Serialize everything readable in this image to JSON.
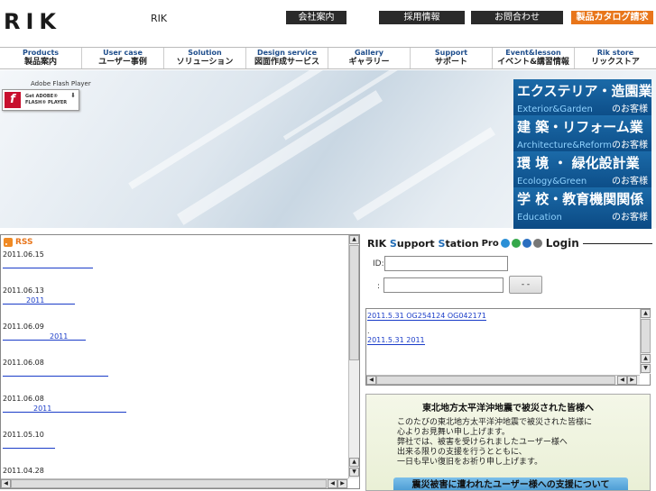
{
  "header": {
    "logo": "RIK",
    "site_name": "RIK",
    "top_buttons": [
      "会社案内",
      "採用情報",
      "お問合わせ"
    ],
    "catalog_button": "製品カタログ請求"
  },
  "nav": [
    {
      "en": "Products",
      "jp": "製品案内"
    },
    {
      "en": "User case",
      "jp": "ユーザー事例"
    },
    {
      "en": "Solution",
      "jp": "ソリューション"
    },
    {
      "en": "Design service",
      "jp": "図面作成サービス"
    },
    {
      "en": "Gallery",
      "jp": "ギャラリー"
    },
    {
      "en": "Support",
      "jp": "サポート"
    },
    {
      "en": "Event&lesson",
      "jp": "イベント&講習情報"
    },
    {
      "en": "Rik store",
      "jp": "リックストア"
    }
  ],
  "flash": {
    "label": "Adobe Flash Player",
    "badge_line1": "Get ADOBE®",
    "badge_line2": "FLASH® PLAYER"
  },
  "customers": [
    {
      "jp": "エクステリア・造園業",
      "en": "Exterior&Garden",
      "suffix": "のお客様"
    },
    {
      "jp": "建 築・リフォーム業",
      "en": "Architecture&Reform",
      "suffix": "のお客様"
    },
    {
      "jp": "環 境 ・ 緑化設計業",
      "en": "Ecology&Green",
      "suffix": "のお客様"
    },
    {
      "jp": "学 校・教育機関関係",
      "en": "Education",
      "suffix": "のお客様"
    }
  ],
  "rss": {
    "label": "RSS",
    "items": [
      {
        "date": "2011.06.15",
        "link": ""
      },
      {
        "date": "2011.06.13",
        "link": "2011"
      },
      {
        "date": "2011.06.09",
        "link": "2011"
      },
      {
        "date": "2011.06.08",
        "link": ""
      },
      {
        "date": "2011.06.08",
        "link": "2011"
      },
      {
        "date": "2011.05.10",
        "link": ""
      },
      {
        "date": "2011.04.28",
        "link": ""
      }
    ]
  },
  "support_station": {
    "title_a": "RIK ",
    "title_b": "S",
    "title_c": "upport ",
    "title_d": "S",
    "title_e": "tation",
    "pro": "Pro",
    "login": "Login",
    "id_label": "ID:",
    "pw_label": ":",
    "login_button": "- -"
  },
  "link_box": {
    "row1": "2011.5.31          OG254124    OG042171",
    "row2": ".",
    "row3": "2011.5.31          2011"
  },
  "notice": {
    "heading": "東北地方太平洋沖地震で被災された皆様へ",
    "lines": [
      "このたびの東北地方太平洋沖地震で被災された皆様に",
      "心よりお見舞い申し上げます。",
      "弊社では、被害を受けられましたユーザー様へ",
      "出来る限りの支援を行うとともに、",
      "一日も早い復旧をお祈り申し上げます。"
    ],
    "support_button": "震災被害に遭われたユーザー様への支援について"
  }
}
